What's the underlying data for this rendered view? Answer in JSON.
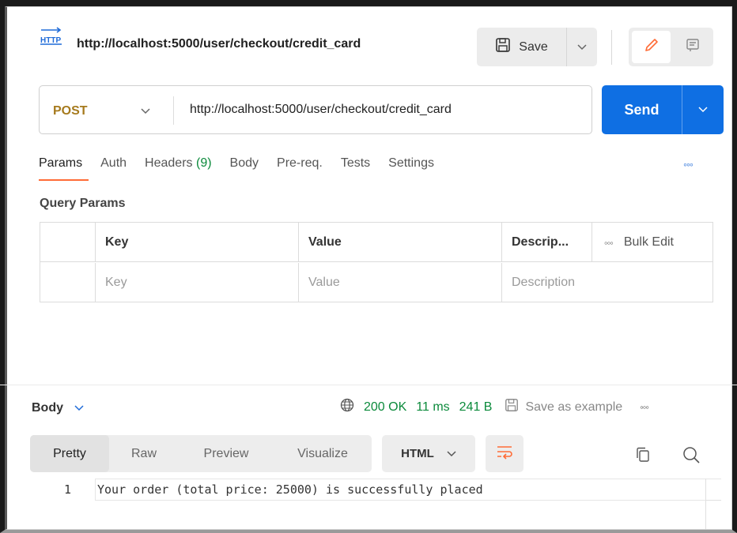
{
  "request": {
    "badge": "HTTP",
    "title": "http://localhost:5000/user/checkout/credit_card",
    "save_label": "Save",
    "method": "POST",
    "url": "http://localhost:5000/user/checkout/credit_card",
    "send_label": "Send"
  },
  "tabs": {
    "params": "Params",
    "auth": "Auth",
    "headers": "Headers",
    "headers_count": "(9)",
    "body": "Body",
    "prereq": "Pre-req.",
    "tests": "Tests",
    "settings": "Settings"
  },
  "query_params": {
    "title": "Query Params",
    "headers": {
      "key": "Key",
      "value": "Value",
      "description": "Descrip...",
      "bulk_edit": "Bulk Edit"
    },
    "placeholders": {
      "key": "Key",
      "value": "Value",
      "description": "Description"
    }
  },
  "response": {
    "body_label": "Body",
    "status": "200 OK",
    "time": "11 ms",
    "size": "241 B",
    "save_example": "Save as example",
    "view_tabs": [
      "Pretty",
      "Raw",
      "Preview",
      "Visualize"
    ],
    "active_view": "Pretty",
    "format": "HTML",
    "line_number": "1",
    "content": "Your order (total price: 25000) is successfully placed"
  },
  "colors": {
    "accent": "#ff6c37",
    "send": "#0f6fe3",
    "method": "#a67a1d",
    "status_ok": "#0b8a3b"
  },
  "icons": [
    "http-icon",
    "save-icon",
    "chevron-down-icon",
    "pencil-icon",
    "comment-icon",
    "more-icon",
    "globe-icon",
    "wrap-lines-icon",
    "copy-icon",
    "search-icon"
  ]
}
